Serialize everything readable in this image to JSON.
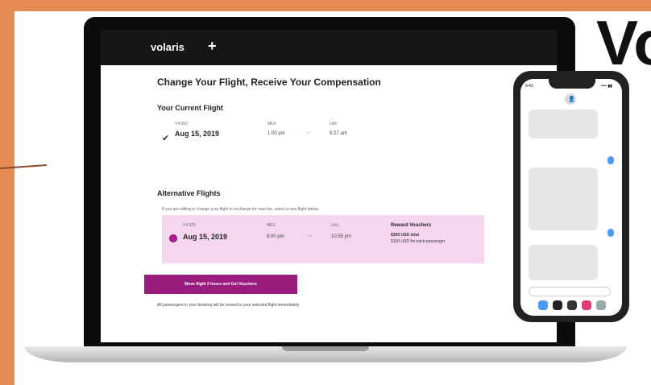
{
  "headline": "Vo",
  "app": {
    "brand": "volaris",
    "title": "Change Your Flight, Receive Your Compensation",
    "current_section": "Your Current Flight",
    "current_flight": {
      "label_small": "Y4 000",
      "date": "Aug 15, 2019",
      "from_code": "MEX",
      "from_time": "1:00 pm",
      "to_code": "LAX",
      "to_time": "5:27 am"
    },
    "alternative_section": "Alternative Flights",
    "alternative_desc": "If you are willing to change your flight in exchange for voucher, select a new flight below.",
    "alternative_flight": {
      "label_small": "Y4 925",
      "date": "Aug 15, 2019",
      "from_code": "MEX",
      "from_time": "8:00 pm",
      "to_code": "LAX",
      "to_time": "10:55 pm",
      "reward_title": "Reward Vouchers",
      "reward_line1": "$300 USD total",
      "reward_line2": "$150 USD for each passenger"
    },
    "cta": "Move flight 2 hours and Get Vouchers",
    "footnote": "All passengers in your booking will be moved to your selected flight immediately"
  },
  "phone": {
    "time": "9:41",
    "signal": "•••• ▮▮"
  },
  "colors": {
    "accent": "#9a1d7e",
    "card_bg": "#f5d6ee",
    "orange": "#e58a52"
  }
}
